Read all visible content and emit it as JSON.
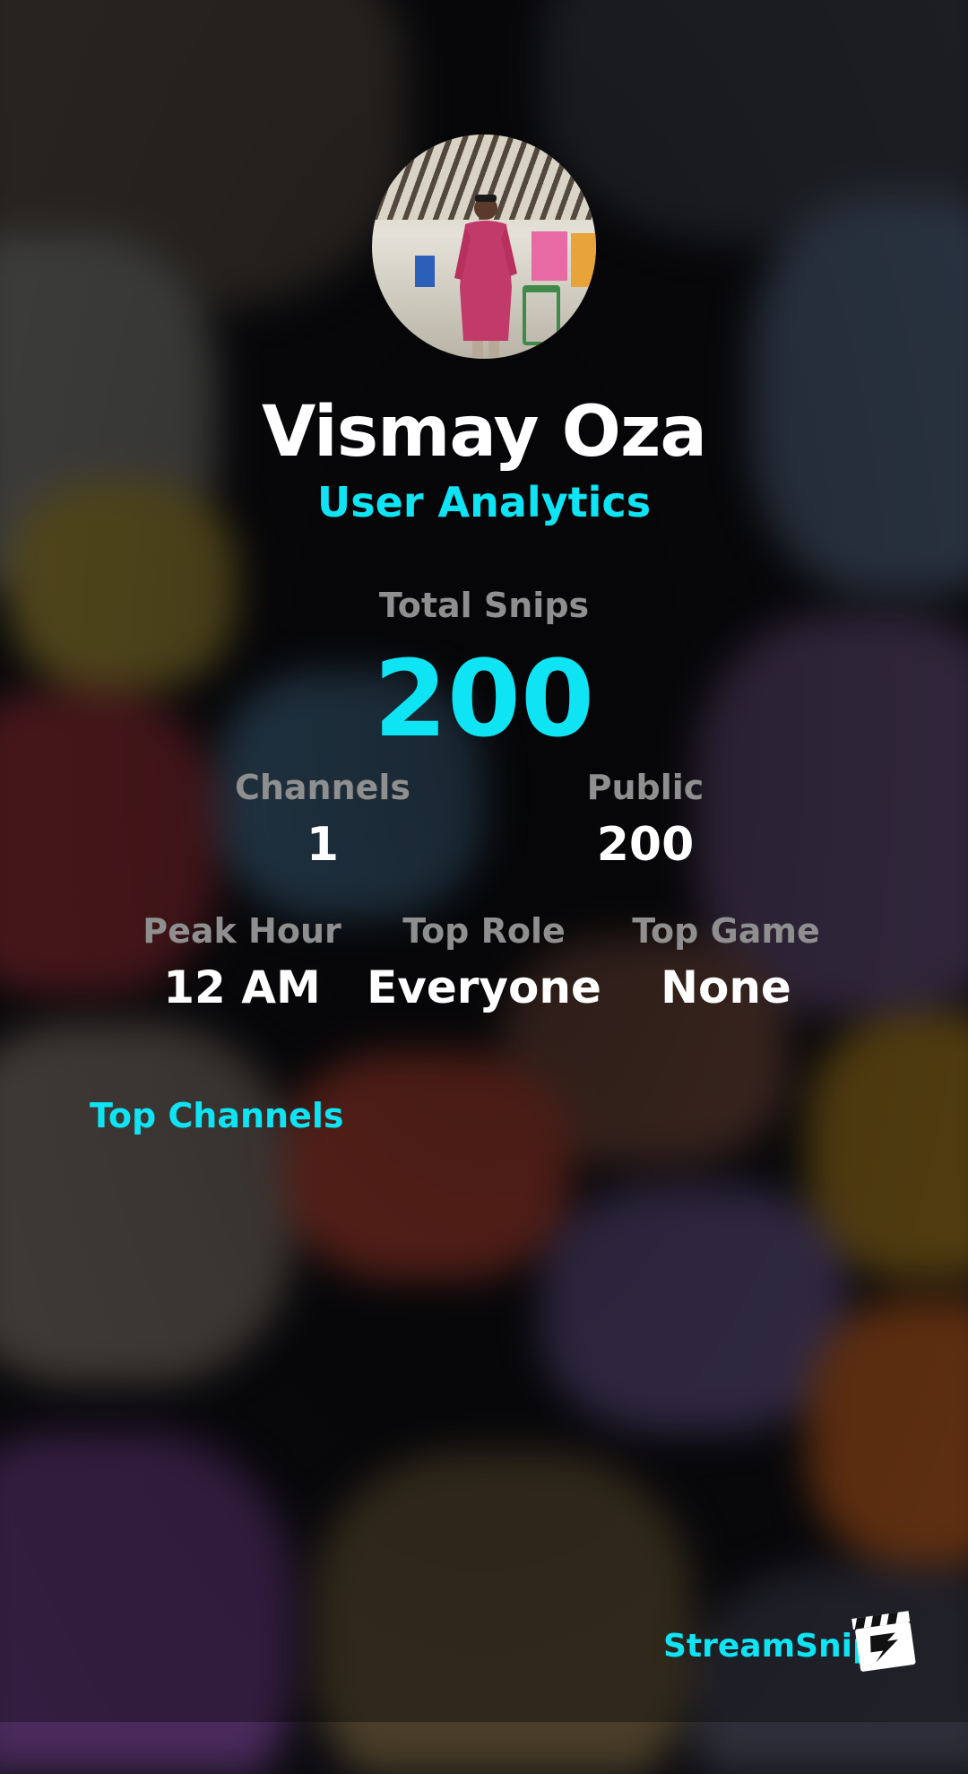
{
  "profile": {
    "name": "Vismay Oza",
    "subtitle": "User Analytics",
    "avatar_icon": "avatar-photo"
  },
  "stats": {
    "total_snips_label": "Total Snips",
    "total_snips_value": "200",
    "channels_label": "Channels",
    "channels_value": "1",
    "public_label": "Public",
    "public_value": "200",
    "peak_hour_label": "Peak Hour",
    "peak_hour_value": "12 AM",
    "top_role_label": "Top Role",
    "top_role_value": "Everyone",
    "top_game_label": "Top Game",
    "top_game_value": "None"
  },
  "sections": {
    "top_channels_label": "Top Channels"
  },
  "footer": {
    "brand_name": "StreamSnip",
    "logo_icon": "clapperboard-icon"
  },
  "colors": {
    "accent": "#0ee4f4",
    "label": "#8f8f8f",
    "value": "#ffffff",
    "background": "#0c0c10"
  }
}
